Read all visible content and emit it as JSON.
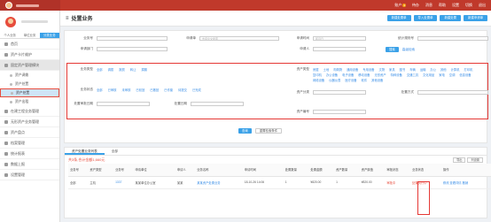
{
  "topbar": {
    "items": [
      {
        "label": "账户",
        "badge": "4"
      },
      {
        "label": "待办"
      },
      {
        "label": "消息"
      },
      {
        "label": "帮助"
      },
      {
        "label": "设置"
      },
      {
        "label": "切换"
      },
      {
        "label": "退出"
      }
    ]
  },
  "sidebar": {
    "tabs": [
      "个人业务",
      "单位业务",
      "分类业务"
    ],
    "menu": [
      {
        "label": "首页"
      },
      {
        "label": "资产卡片维护"
      },
      {
        "label": "固定资产管理模块"
      }
    ],
    "submenu": [
      {
        "label": "资产调拨"
      },
      {
        "label": "资产处置"
      },
      {
        "label": "资产处置"
      }
    ],
    "menu2": [
      {
        "label": "资产出租"
      },
      {
        "label": "在建工程业务管理"
      },
      {
        "label": "无形资产业务管理"
      },
      {
        "label": "资产盘点"
      },
      {
        "label": "档案管理"
      },
      {
        "label": "统计报表"
      },
      {
        "label": "数据上报"
      },
      {
        "label": "设置管理"
      }
    ]
  },
  "header": {
    "title": "处置业务",
    "buttons": [
      "新建处置单",
      "导入处置单",
      "新建处置",
      "新建申请单"
    ]
  },
  "form": {
    "row1": {
      "l1": "业务号",
      "l2": "申请单",
      "p2": "支持全文搜索",
      "l3": "申请时间",
      "v3": "年月日",
      "l4": "统计规则号"
    },
    "row2": {
      "l1": "申请部门",
      "l3": "申请人"
    },
    "search_label": "搜索",
    "adv_label": "高级检索",
    "types_label": "业务类型",
    "types": [
      "全部",
      "调拨",
      "报损",
      "转让",
      "捐赠"
    ],
    "asset_type_label": "资产类型",
    "asset_types": [
      "房屋",
      "土地",
      "构筑物",
      "通用设备",
      "专用设备",
      "文物",
      "家具",
      "图书",
      "车辆",
      "运输",
      "办公",
      "其他",
      "计算机",
      "打印机",
      "复印机",
      "办公设备",
      "电子设备",
      "移动设备",
      "无形资产",
      "特种设备",
      "交通工具",
      "文化用品",
      "家电",
      "空调",
      "信息设备",
      "网络设备",
      "仪器仪表",
      "医疗设备",
      "软件",
      "其他设备"
    ],
    "status_label": "业务状态",
    "statuses": [
      "全部",
      "已审核",
      "未审核",
      "已驳回",
      "已撤回",
      "已作废",
      "待提交",
      "已完成"
    ],
    "dept_label": "资产分类",
    "cat_label": "处置方式",
    "dateA_label": "处置审批日期",
    "dateB_label": "处置日期",
    "num_label": "资产编号",
    "btn_search": "查询",
    "btn_reset": "重置检索条件"
  },
  "result": {
    "tabs": [
      "资产处置业务列表",
      "全部"
    ],
    "summary": "共3条,合计金额1,660元",
    "tools": [
      "导出",
      "列设置"
    ],
    "columns": [
      "业务号",
      "资产类型",
      "业务号",
      "申请单位",
      "申请人",
      "业务名称",
      "申请时间",
      "处置数量",
      "处置金额",
      "资产数量",
      "资产原值",
      "审批状态",
      "业务状态",
      "操作"
    ],
    "row": [
      "全部",
      "主机",
      "1337",
      "某某单位办公室",
      "某某",
      "某某资产处置业务",
      "18-10-26 14:06",
      "1",
      "¥820.00",
      "1",
      "¥820.00",
      "审批中",
      "处置执行中",
      "修改"
    ],
    "actions": [
      "查看详情",
      "撤销"
    ],
    "extra": [
      "审批记录",
      "打印单据"
    ]
  }
}
